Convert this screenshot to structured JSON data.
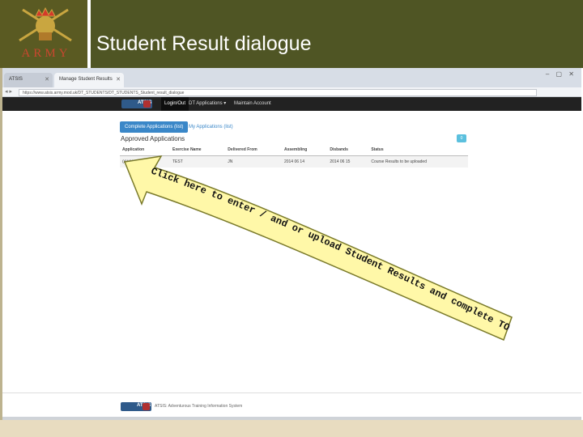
{
  "slide": {
    "title": "Student Result dialogue",
    "logo_text": "ARMY",
    "colors": {
      "header_band": "#4f5524",
      "logo_box": "#5a5a22",
      "logo_text": "#c9472f",
      "footer_band": "#e8dcc0"
    }
  },
  "browser": {
    "tabs": [
      "ATSIS",
      "Manage Student Results"
    ],
    "url": "https://www.atsis.army.mod.uk/DT_STUDENTS/DT_STUDENTS_Student_result_dialogue",
    "window_controls": "–  ▢  ✕"
  },
  "app": {
    "logo_text": "ATSIS",
    "nav": {
      "login": "Login/Out",
      "dt": "DT Applications ▾",
      "maint": "Maintain Account"
    },
    "tabs": {
      "complete": "Complete Applications (list)",
      "mine": "My Applications (list)"
    },
    "badge": "0",
    "section_title": "Approved Applications",
    "table": {
      "headers": [
        "Application",
        "Exercise Name",
        "Delivered From",
        "Assembling",
        "Disbands",
        "Status"
      ],
      "rows": [
        [
          "0012111",
          "TEST",
          "JN",
          "2014 06 14",
          "2014 06 15",
          "Course Results to be uploaded"
        ]
      ]
    },
    "footer_text": "ATSIS: Adventurous Training Information System",
    "colors": {
      "navbar": "#222222",
      "primary": "#3a87c8",
      "info": "#5bc0de"
    }
  },
  "annotation": {
    "lines": [
      "Click here to enter / and or upload Student Results and complete TO's Summary form"
    ],
    "colors": {
      "arrow_fill": "#fff8a8",
      "arrow_stroke": "#7a7a2a",
      "text": "#111111"
    }
  }
}
